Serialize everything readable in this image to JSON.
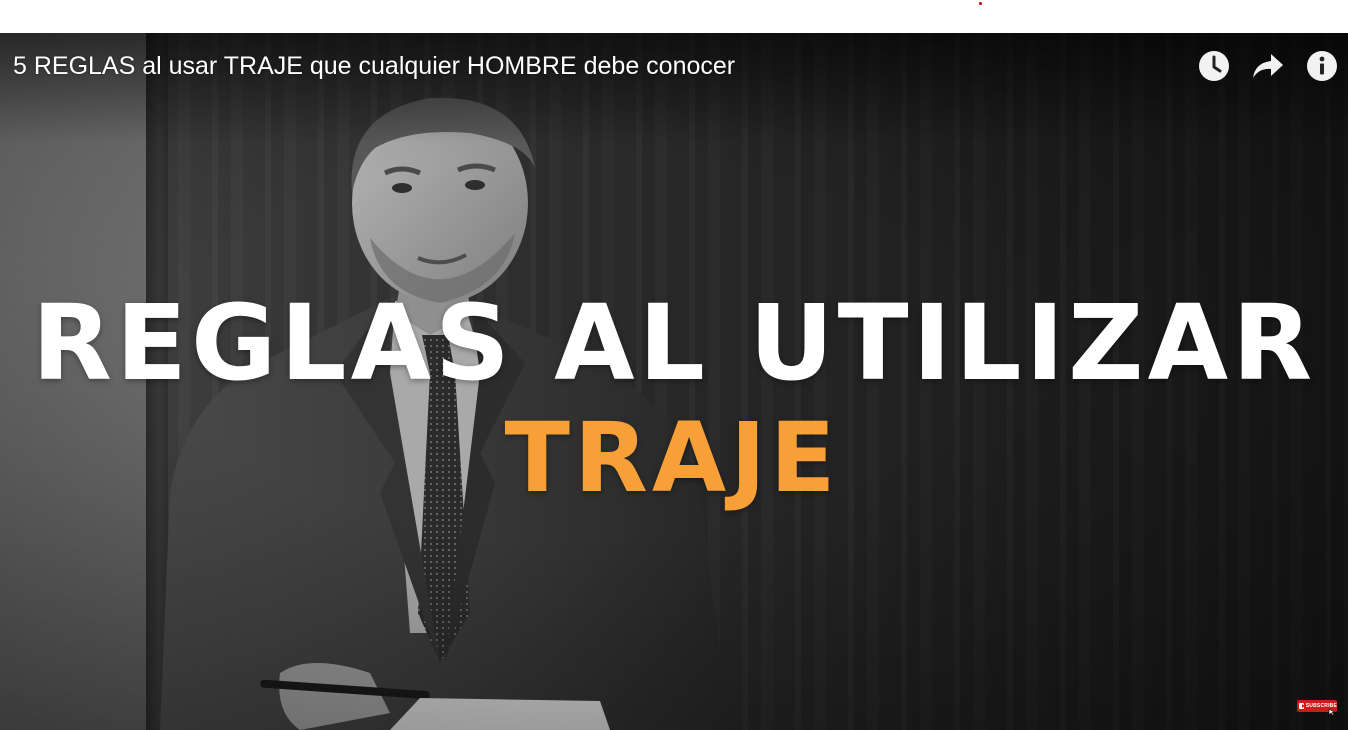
{
  "video": {
    "title": "5 REGLAS al usar TRAJE que cualquier HOMBRE debe conocer",
    "headline": "REGLAS AL UTILIZAR",
    "subheadline": "TRAJE",
    "headline_color": "#ffffff",
    "subheadline_color": "#f7a038"
  },
  "controls": {
    "watch_later_icon": "clock-icon",
    "share_icon": "share-arrow-icon",
    "info_icon": "info-icon"
  },
  "subscribe_badge": {
    "label": "SUBSCRIBE",
    "color": "#cc1b1b"
  },
  "colors": {
    "accent_orange": "#f7a038",
    "top_dot": "#cc0000"
  }
}
